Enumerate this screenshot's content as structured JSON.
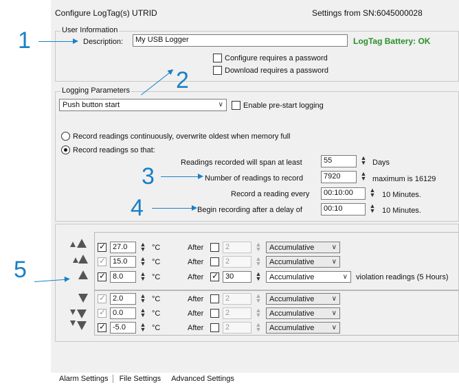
{
  "header": {
    "title": "Configure LogTag(s) UTRID",
    "sn": "Settings from SN:6045000028"
  },
  "user_info": {
    "legend": "User Information",
    "description_label": "Description:",
    "description_value": "My USB Logger",
    "battery_status": "LogTag Battery: OK",
    "config_pwd_label": "Configure requires a password",
    "download_pwd_label": "Download requires a password"
  },
  "logging": {
    "legend": "Logging Parameters",
    "start_mode": "Push button start",
    "prestart_label": "Enable pre-start logging",
    "radio_continuous": "Record readings continuously, overwrite oldest when memory full",
    "radio_so_that": "Record readings so that:",
    "span_label": "Readings recorded will span at least",
    "span_value": "55",
    "span_unit": "Days",
    "num_label": "Number of readings to record",
    "num_value": "7920",
    "num_max": "maximum is 16129",
    "every_label": "Record a reading every",
    "every_value": "00:10:00",
    "every_unit": "10 Minutes.",
    "delay_label": "Begin recording after a delay of",
    "delay_value": "00:10",
    "delay_unit": "10 Minutes."
  },
  "alarms": {
    "unit": "°C",
    "after_label": "After",
    "violation_text": "violation readings (5 Hours)",
    "rows": [
      {
        "checked": true,
        "temp": "27.0",
        "after_checked": false,
        "after_count": "2",
        "mode": "Accumulative"
      },
      {
        "checked": true,
        "temp": "15.0",
        "after_checked": false,
        "after_count": "2",
        "mode": "Accumulative"
      },
      {
        "checked": true,
        "temp": "8.0",
        "after_checked": true,
        "after_count": "30",
        "mode": "Accumulative"
      },
      {
        "checked": true,
        "temp": "2.0",
        "after_checked": false,
        "after_count": "2",
        "mode": "Accumulative"
      },
      {
        "checked": true,
        "temp": "0.0",
        "after_checked": false,
        "after_count": "2",
        "mode": "Accumulative"
      },
      {
        "checked": true,
        "temp": "-5.0",
        "after_checked": false,
        "after_count": "2",
        "mode": "Accumulative"
      }
    ]
  },
  "tabs": [
    "Alarm Settings",
    "File Settings",
    "Advanced Settings"
  ],
  "annotations": {
    "n1": "1",
    "n2": "2",
    "n3": "3",
    "n4": "4",
    "n5": "5"
  },
  "colors": {
    "annotation": "#1a80c6",
    "battery_ok": "#2a8f2a"
  }
}
